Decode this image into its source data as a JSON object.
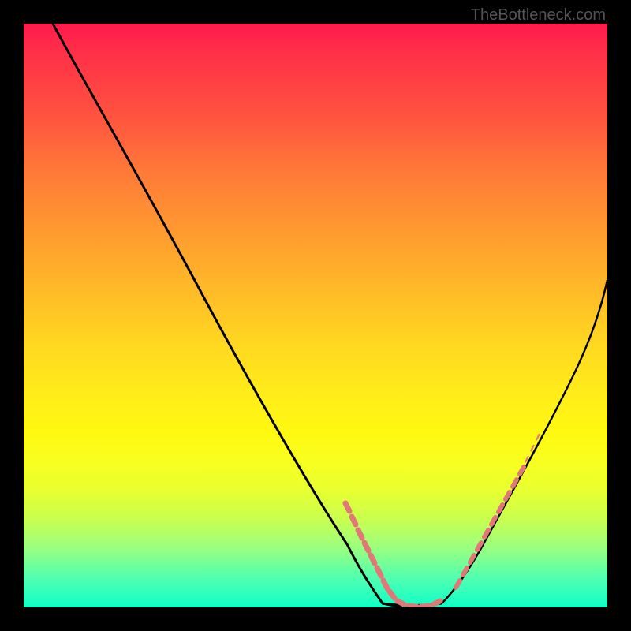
{
  "watermark": "TheBottleneck.com",
  "colors": {
    "background": "#000000",
    "curve_stroke": "#000000",
    "dash_color": "#d46a6a"
  },
  "chart_data": {
    "type": "line",
    "title": "",
    "xlabel": "",
    "ylabel": "",
    "xlim": [
      0,
      100
    ],
    "ylim": [
      0,
      100
    ],
    "series": [
      {
        "name": "left-curve",
        "x": [
          5,
          10,
          15,
          20,
          25,
          30,
          35,
          40,
          45,
          50,
          55,
          57,
          60,
          63,
          65
        ],
        "values": [
          100,
          92,
          84,
          76,
          68,
          60,
          52,
          44,
          36,
          28,
          18,
          12,
          6,
          2,
          0
        ]
      },
      {
        "name": "right-curve",
        "x": [
          65,
          70,
          75,
          80,
          85,
          90,
          95,
          100
        ],
        "values": [
          0,
          3,
          10,
          20,
          31,
          43,
          52,
          58
        ]
      }
    ],
    "dashed_regions": [
      {
        "side": "left",
        "x_range": [
          55,
          65
        ],
        "y_range": [
          0,
          18
        ]
      },
      {
        "side": "right",
        "x_range": [
          72,
          85
        ],
        "y_range": [
          4,
          31
        ]
      }
    ]
  }
}
